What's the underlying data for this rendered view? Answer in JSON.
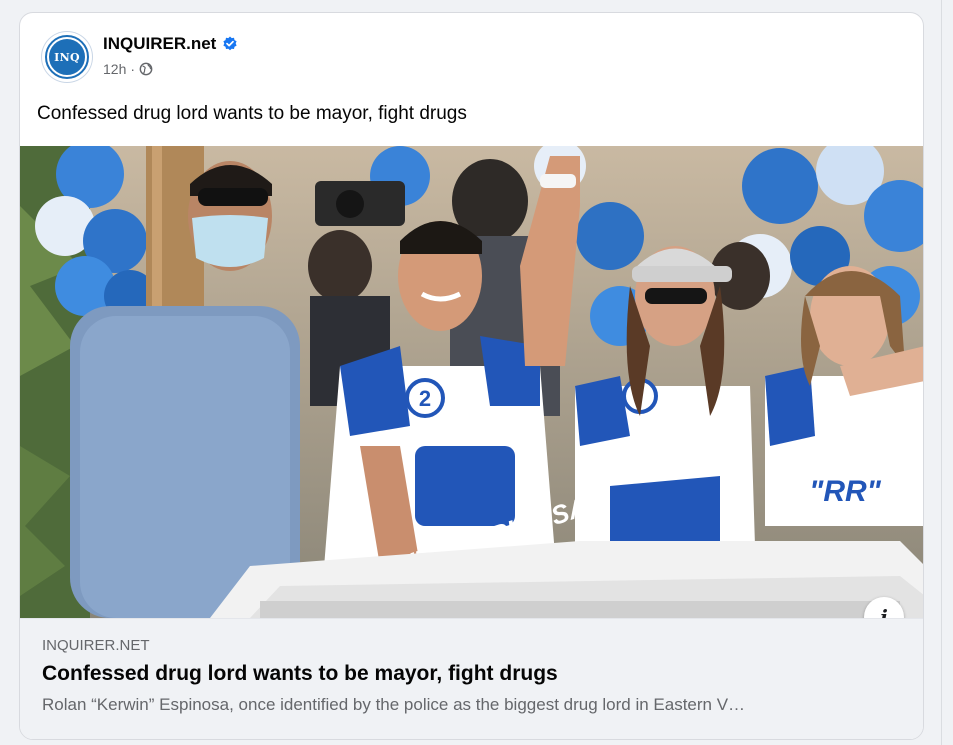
{
  "post": {
    "page_name": "INQUIRER.net",
    "avatar_text": "INQ",
    "verified_icon": "verified-badge-icon",
    "timestamp": "12h",
    "separator": "·",
    "audience_icon": "globe-icon",
    "text": "Confessed drug lord wants to be mayor, fight drugs"
  },
  "media": {
    "jersey_number": "2",
    "jersey_text": "\"KERWIN\" ESPINOSA",
    "jersey_text_right": "\"RR\""
  },
  "link_preview": {
    "domain": "INQUIRER.NET",
    "title": "Confessed drug lord wants to be mayor, fight drugs",
    "description": "Rolan “Kerwin” Espinosa, once identified by the police as the biggest drug lord in Eastern V…",
    "info_icon_label": "i"
  },
  "colors": {
    "brand_blue": "#1d6fb8",
    "verified_blue": "#1877f2",
    "preview_bg": "#f0f2f5"
  }
}
